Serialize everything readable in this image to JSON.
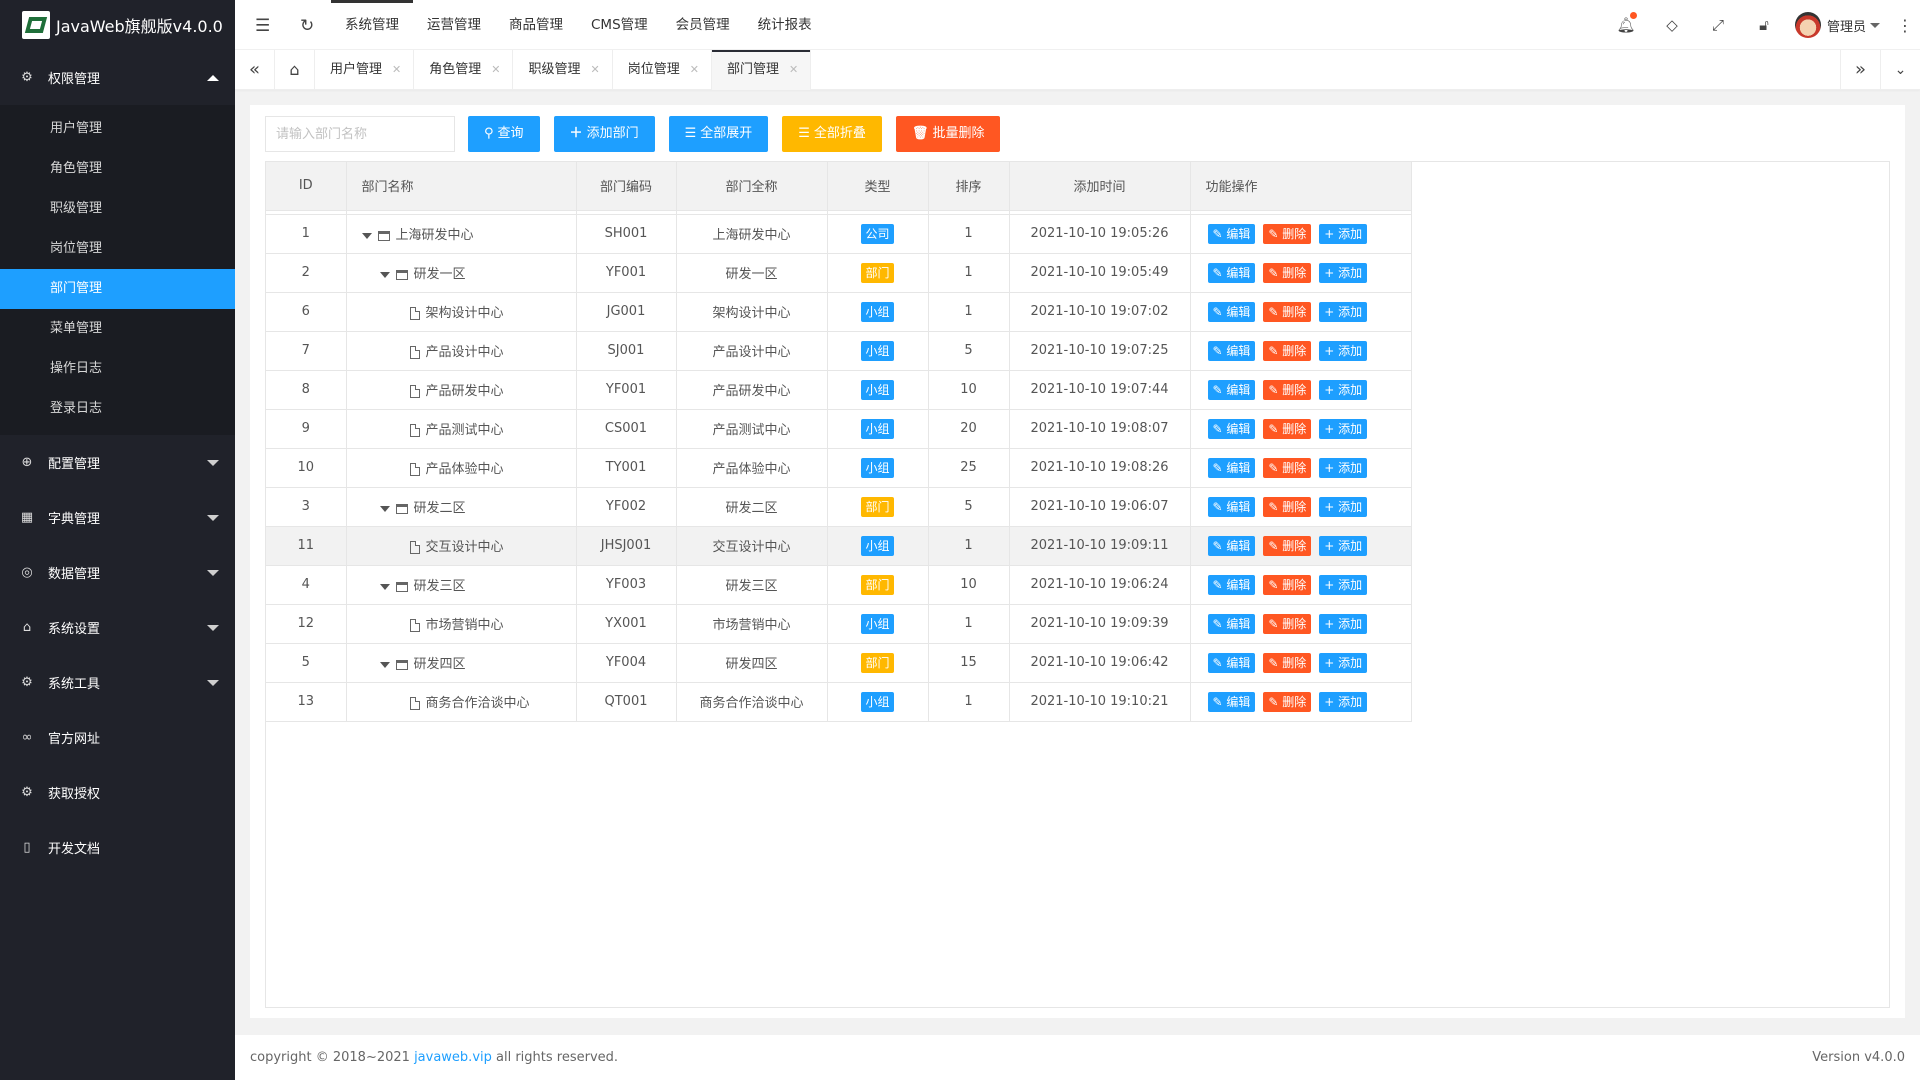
{
  "app": {
    "title": "JavaWeb旗舰版v4.0.0"
  },
  "sidebar": {
    "groups": [
      {
        "label": "权限管理",
        "icon": "gear-icon",
        "expanded": true,
        "items": [
          {
            "label": "用户管理"
          },
          {
            "label": "角色管理"
          },
          {
            "label": "职级管理"
          },
          {
            "label": "岗位管理"
          },
          {
            "label": "部门管理",
            "active": true
          },
          {
            "label": "菜单管理"
          },
          {
            "label": "操作日志"
          },
          {
            "label": "登录日志"
          }
        ]
      },
      {
        "label": "配置管理",
        "icon": "globe-icon"
      },
      {
        "label": "字典管理",
        "icon": "apps-icon"
      },
      {
        "label": "数据管理",
        "icon": "database-icon"
      },
      {
        "label": "系统设置",
        "icon": "home-icon"
      },
      {
        "label": "系统工具",
        "icon": "settings-icon"
      },
      {
        "label": "官方网址",
        "icon": "link-icon"
      },
      {
        "label": "获取授权",
        "icon": "gear-icon"
      },
      {
        "label": "开发文档",
        "icon": "book-icon"
      }
    ]
  },
  "header": {
    "top_nav": [
      "系统管理",
      "运营管理",
      "商品管理",
      "CMS管理",
      "会员管理",
      "统计报表"
    ],
    "user": "管理员"
  },
  "tabs": [
    "用户管理",
    "角色管理",
    "职级管理",
    "岗位管理",
    "部门管理"
  ],
  "toolbar": {
    "search_placeholder": "请输入部门名称",
    "query": "查询",
    "add": "添加部门",
    "expand_all": "全部展开",
    "collapse_all": "全部折叠",
    "batch_delete": "批量删除"
  },
  "table": {
    "columns": [
      "ID",
      "部门名称",
      "部门编码",
      "部门全称",
      "类型",
      "排序",
      "添加时间",
      "功能操作"
    ],
    "ops": {
      "edit": "编辑",
      "delete": "删除",
      "add": "添加"
    },
    "rows": [
      {
        "id": "1",
        "name": "上海研发中心",
        "level": 0,
        "node": "folder",
        "code": "SH001",
        "full": "上海研发中心",
        "type": "公司",
        "type_color": "blue",
        "sort": "1",
        "time": "2021-10-10 19:05:26"
      },
      {
        "id": "2",
        "name": "研发一区",
        "level": 1,
        "node": "folder",
        "code": "YF001",
        "full": "研发一区",
        "type": "部门",
        "type_color": "orange",
        "sort": "1",
        "time": "2021-10-10 19:05:49"
      },
      {
        "id": "6",
        "name": "架构设计中心",
        "level": 2,
        "node": "file",
        "code": "JG001",
        "full": "架构设计中心",
        "type": "小组",
        "type_color": "blue",
        "sort": "1",
        "time": "2021-10-10 19:07:02"
      },
      {
        "id": "7",
        "name": "产品设计中心",
        "level": 2,
        "node": "file",
        "code": "SJ001",
        "full": "产品设计中心",
        "type": "小组",
        "type_color": "blue",
        "sort": "5",
        "time": "2021-10-10 19:07:25"
      },
      {
        "id": "8",
        "name": "产品研发中心",
        "level": 2,
        "node": "file",
        "code": "YF001",
        "full": "产品研发中心",
        "type": "小组",
        "type_color": "blue",
        "sort": "10",
        "time": "2021-10-10 19:07:44"
      },
      {
        "id": "9",
        "name": "产品测试中心",
        "level": 2,
        "node": "file",
        "code": "CS001",
        "full": "产品测试中心",
        "type": "小组",
        "type_color": "blue",
        "sort": "20",
        "time": "2021-10-10 19:08:07"
      },
      {
        "id": "10",
        "name": "产品体验中心",
        "level": 2,
        "node": "file",
        "code": "TY001",
        "full": "产品体验中心",
        "type": "小组",
        "type_color": "blue",
        "sort": "25",
        "time": "2021-10-10 19:08:26"
      },
      {
        "id": "3",
        "name": "研发二区",
        "level": 1,
        "node": "folder",
        "code": "YF002",
        "full": "研发二区",
        "type": "部门",
        "type_color": "orange",
        "sort": "5",
        "time": "2021-10-10 19:06:07"
      },
      {
        "id": "11",
        "name": "交互设计中心",
        "level": 2,
        "node": "file",
        "code": "JHSJ001",
        "full": "交互设计中心",
        "type": "小组",
        "type_color": "blue",
        "sort": "1",
        "time": "2021-10-10 19:09:11",
        "hover": true
      },
      {
        "id": "4",
        "name": "研发三区",
        "level": 1,
        "node": "folder",
        "code": "YF003",
        "full": "研发三区",
        "type": "部门",
        "type_color": "orange",
        "sort": "10",
        "time": "2021-10-10 19:06:24"
      },
      {
        "id": "12",
        "name": "市场营销中心",
        "level": 2,
        "node": "file",
        "code": "YX001",
        "full": "市场营销中心",
        "type": "小组",
        "type_color": "blue",
        "sort": "1",
        "time": "2021-10-10 19:09:39"
      },
      {
        "id": "5",
        "name": "研发四区",
        "level": 1,
        "node": "folder",
        "code": "YF004",
        "full": "研发四区",
        "type": "部门",
        "type_color": "orange",
        "sort": "15",
        "time": "2021-10-10 19:06:42"
      },
      {
        "id": "13",
        "name": "商务合作洽谈中心",
        "level": 2,
        "node": "file",
        "code": "QT001",
        "full": "商务合作洽谈中心",
        "type": "小组",
        "type_color": "blue",
        "sort": "1",
        "time": "2021-10-10 19:10:21"
      }
    ]
  },
  "footer": {
    "prefix": "copyright © 2018~2021 ",
    "link": "javaweb.vip",
    "suffix": " all rights reserved.",
    "version": "Version v4.0.0"
  }
}
